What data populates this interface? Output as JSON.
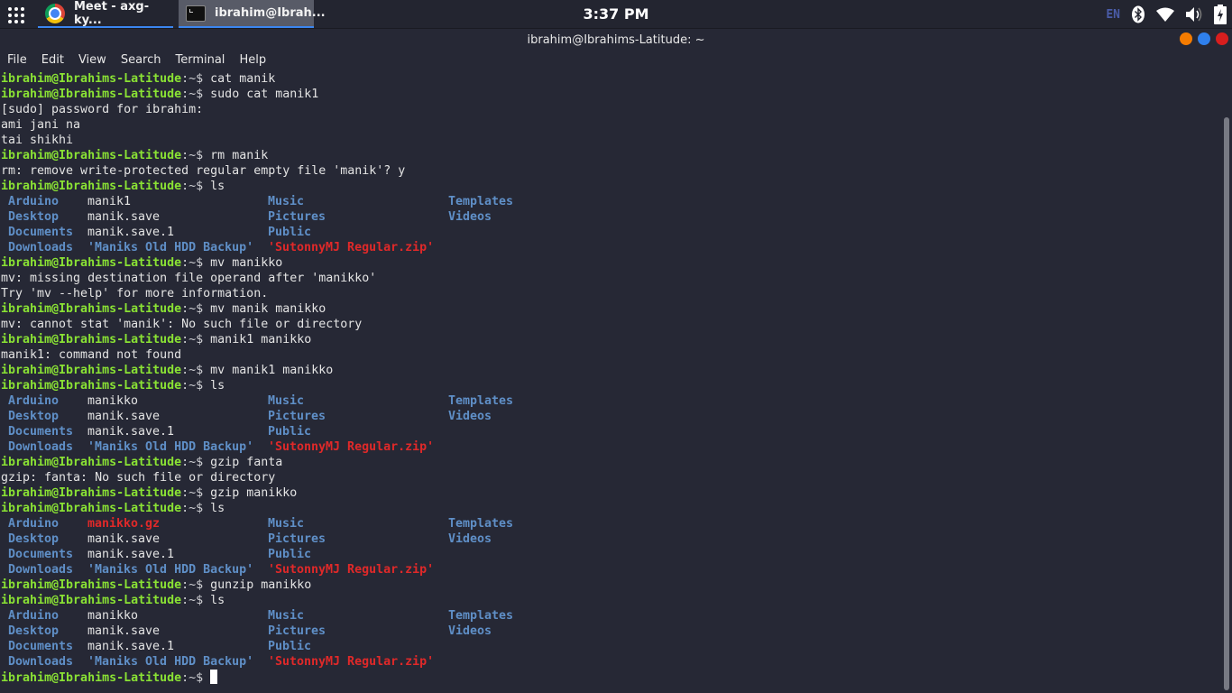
{
  "panel": {
    "tasks": [
      {
        "icon": "chrome-icon",
        "label": "Meet - axg-ky..."
      },
      {
        "icon": "terminal-icon",
        "label": "ibrahim@Ibrah..."
      }
    ],
    "clock": "3:37 PM",
    "tray": {
      "language": "EN",
      "icons": [
        "bluetooth-icon",
        "wifi-icon",
        "volume-icon",
        "battery-charging-icon"
      ]
    }
  },
  "window": {
    "title": "ibrahim@Ibrahims-Latitude: ~",
    "controls": {
      "minimize": "#f57c00",
      "maximize": "#2f80ed",
      "close": "#d81e1e"
    }
  },
  "menu": [
    "File",
    "Edit",
    "View",
    "Search",
    "Terminal",
    "Help"
  ],
  "prompt": {
    "user_host": "ibrahim@Ibrahims-Latitude",
    "path": ":~$ "
  },
  "colors": {
    "prompt_user": "#8ae234",
    "directory": "#5f8fc7",
    "archive": "#e02929",
    "background": "#262835",
    "text": "#e4e4e4"
  },
  "terminal": {
    "lines": [
      {
        "type": "cmd",
        "text": "cat manik"
      },
      {
        "type": "cmd",
        "text": "sudo cat manik1"
      },
      {
        "type": "out",
        "text": "[sudo] password for ibrahim:"
      },
      {
        "type": "out",
        "text": "ami jani na"
      },
      {
        "type": "out",
        "text": "tai shikhi"
      },
      {
        "type": "cmd",
        "text": "rm manik"
      },
      {
        "type": "out",
        "text": "rm: remove write-protected regular empty file 'manik'? y"
      },
      {
        "type": "cmd",
        "text": "ls"
      },
      {
        "type": "ls",
        "cells": [
          [
            "Arduino",
            "dir"
          ],
          [
            "manik1",
            "fil"
          ],
          [
            "Music",
            "dir"
          ],
          [
            "Templates",
            "dir"
          ]
        ]
      },
      {
        "type": "ls",
        "cells": [
          [
            "Desktop",
            "dir"
          ],
          [
            "manik.save",
            "fil"
          ],
          [
            "Pictures",
            "dir"
          ],
          [
            "Videos",
            "dir"
          ]
        ]
      },
      {
        "type": "ls",
        "cells": [
          [
            "Documents",
            "dir"
          ],
          [
            "manik.save.1",
            "fil"
          ],
          [
            "Public",
            "dir"
          ],
          [
            "",
            ""
          ]
        ]
      },
      {
        "type": "ls",
        "cells": [
          [
            "Downloads",
            "dir"
          ],
          [
            "'Maniks Old HDD Backup'",
            "dir"
          ],
          [
            "'SutonnyMJ Regular.zip'",
            "arc"
          ],
          [
            "",
            ""
          ]
        ]
      },
      {
        "type": "cmd",
        "text": "mv manikko"
      },
      {
        "type": "out",
        "text": "mv: missing destination file operand after 'manikko'"
      },
      {
        "type": "out",
        "text": "Try 'mv --help' for more information."
      },
      {
        "type": "cmd",
        "text": "mv manik manikko"
      },
      {
        "type": "out",
        "text": "mv: cannot stat 'manik': No such file or directory"
      },
      {
        "type": "cmd",
        "text": "manik1 manikko"
      },
      {
        "type": "out",
        "text": "manik1: command not found"
      },
      {
        "type": "cmd",
        "text": "mv manik1 manikko"
      },
      {
        "type": "cmd",
        "text": "ls"
      },
      {
        "type": "ls",
        "cells": [
          [
            "Arduino",
            "dir"
          ],
          [
            "manikko",
            "fil"
          ],
          [
            "Music",
            "dir"
          ],
          [
            "Templates",
            "dir"
          ]
        ]
      },
      {
        "type": "ls",
        "cells": [
          [
            "Desktop",
            "dir"
          ],
          [
            "manik.save",
            "fil"
          ],
          [
            "Pictures",
            "dir"
          ],
          [
            "Videos",
            "dir"
          ]
        ]
      },
      {
        "type": "ls",
        "cells": [
          [
            "Documents",
            "dir"
          ],
          [
            "manik.save.1",
            "fil"
          ],
          [
            "Public",
            "dir"
          ],
          [
            "",
            ""
          ]
        ]
      },
      {
        "type": "ls",
        "cells": [
          [
            "Downloads",
            "dir"
          ],
          [
            "'Maniks Old HDD Backup'",
            "dir"
          ],
          [
            "'SutonnyMJ Regular.zip'",
            "arc"
          ],
          [
            "",
            ""
          ]
        ]
      },
      {
        "type": "cmd",
        "text": "gzip fanta"
      },
      {
        "type": "out",
        "text": "gzip: fanta: No such file or directory"
      },
      {
        "type": "cmd",
        "text": "gzip manikko"
      },
      {
        "type": "cmd",
        "text": "ls"
      },
      {
        "type": "ls",
        "cells": [
          [
            "Arduino",
            "dir"
          ],
          [
            "manikko.gz",
            "arc"
          ],
          [
            "Music",
            "dir"
          ],
          [
            "Templates",
            "dir"
          ]
        ]
      },
      {
        "type": "ls",
        "cells": [
          [
            "Desktop",
            "dir"
          ],
          [
            "manik.save",
            "fil"
          ],
          [
            "Pictures",
            "dir"
          ],
          [
            "Videos",
            "dir"
          ]
        ]
      },
      {
        "type": "ls",
        "cells": [
          [
            "Documents",
            "dir"
          ],
          [
            "manik.save.1",
            "fil"
          ],
          [
            "Public",
            "dir"
          ],
          [
            "",
            ""
          ]
        ]
      },
      {
        "type": "ls",
        "cells": [
          [
            "Downloads",
            "dir"
          ],
          [
            "'Maniks Old HDD Backup'",
            "dir"
          ],
          [
            "'SutonnyMJ Regular.zip'",
            "arc"
          ],
          [
            "",
            ""
          ]
        ]
      },
      {
        "type": "cmd",
        "text": "gunzip manikko"
      },
      {
        "type": "cmd",
        "text": "ls"
      },
      {
        "type": "ls",
        "cells": [
          [
            "Arduino",
            "dir"
          ],
          [
            "manikko",
            "fil"
          ],
          [
            "Music",
            "dir"
          ],
          [
            "Templates",
            "dir"
          ]
        ]
      },
      {
        "type": "ls",
        "cells": [
          [
            "Desktop",
            "dir"
          ],
          [
            "manik.save",
            "fil"
          ],
          [
            "Pictures",
            "dir"
          ],
          [
            "Videos",
            "dir"
          ]
        ]
      },
      {
        "type": "ls",
        "cells": [
          [
            "Documents",
            "dir"
          ],
          [
            "manik.save.1",
            "fil"
          ],
          [
            "Public",
            "dir"
          ],
          [
            "",
            ""
          ]
        ]
      },
      {
        "type": "ls",
        "cells": [
          [
            "Downloads",
            "dir"
          ],
          [
            "'Maniks Old HDD Backup'",
            "dir"
          ],
          [
            "'SutonnyMJ Regular.zip'",
            "arc"
          ],
          [
            "",
            ""
          ]
        ]
      },
      {
        "type": "prompt",
        "text": ""
      }
    ]
  },
  "scrollbar": {
    "position": "bottom"
  }
}
